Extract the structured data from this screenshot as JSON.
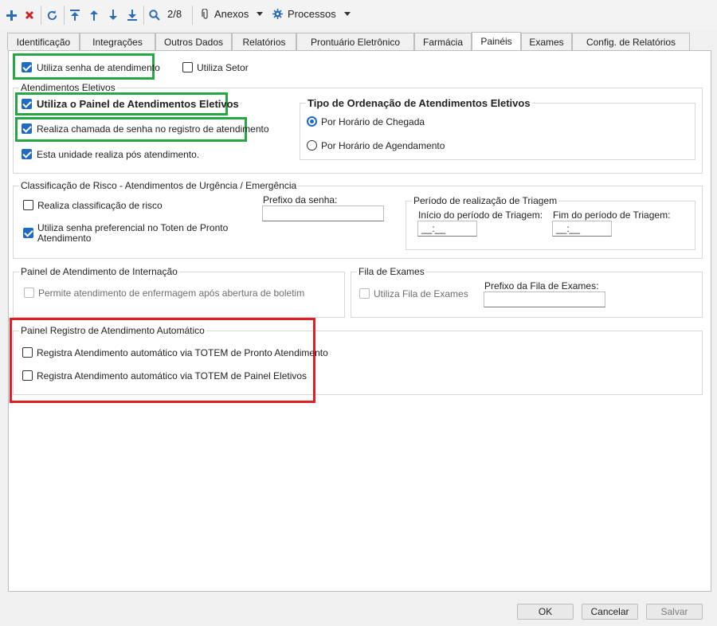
{
  "toolbar": {
    "add_icon": "plus-icon",
    "delete_icon": "x-icon",
    "refresh_icon": "refresh-icon",
    "record_counter": "2/8",
    "anexos_label": "Anexos",
    "processos_label": "Processos",
    "colors": {
      "blue": "#2b6cb8",
      "red": "#d0202a"
    }
  },
  "tabs": [
    {
      "label": "Identificação",
      "active": false
    },
    {
      "label": "Integrações",
      "active": false
    },
    {
      "label": "Outros Dados",
      "active": false
    },
    {
      "label": "Relatórios",
      "active": false
    },
    {
      "label": "Prontuário Eletrônico",
      "active": false
    },
    {
      "label": "Farmácia",
      "active": false
    },
    {
      "label": "Painéis",
      "active": true
    },
    {
      "label": "Exames",
      "active": false
    },
    {
      "label": "Config. de Relatórios",
      "active": false
    }
  ],
  "top": {
    "utiliza_senha": {
      "label": "Utiliza senha de atendimento",
      "checked": true
    },
    "utiliza_setor": {
      "label": "Utiliza Setor",
      "checked": false
    }
  },
  "eletivos": {
    "title": "Atendimentos Eletivos",
    "painel": {
      "label": "Utiliza o Painel de Atendimentos Eletivos",
      "checked": true
    },
    "chamada": {
      "label": "Realiza chamada de senha no registro de atendimento",
      "checked": true
    },
    "pos": {
      "label": "Esta unidade realiza pós atendimento.",
      "checked": true
    },
    "ordenacao_title": "Tipo de Ordenação de Atendimentos Eletivos",
    "ordem_chegada": {
      "label": "Por Horário de Chegada",
      "selected": true
    },
    "ordem_agendamento": {
      "label": "Por Horário de Agendamento",
      "selected": false
    }
  },
  "risco": {
    "title": "Classificação de Risco - Atendimentos de Urgência / Emergência",
    "classificacao": {
      "label": "Realiza classificação de risco",
      "checked": false
    },
    "preferencial_line1": "Utiliza senha preferencial no Toten de Pronto",
    "preferencial_line2": "Atendimento",
    "preferencial_checked": true,
    "prefixo_label": "Prefixo da senha:",
    "prefixo_value": "",
    "triagem_title": "Período de realização de Triagem",
    "inicio_label": "Início do período de Triagem:",
    "inicio_value": "__:__",
    "fim_label": "Fim do período de Triagem:",
    "fim_value": "__:__"
  },
  "internacao": {
    "title": "Painel de Atendimento de Internação",
    "permite": {
      "label": "Permite atendimento de enfermagem após abertura de boletim",
      "checked": false
    }
  },
  "exames": {
    "title": "Fila de Exames",
    "utiliza": {
      "label": "Utiliza Fila de Exames",
      "checked": false
    },
    "prefixo_label": "Prefixo da Fila de Exames:",
    "prefixo_value": ""
  },
  "automatico": {
    "title": "Painel Registro de Atendimento Automático",
    "pronto": {
      "label": "Registra Atendimento automático via TOTEM de Pronto Atendimento",
      "checked": false
    },
    "eletivos": {
      "label": "Registra Atendimento automático via TOTEM de Painel Eletivos",
      "checked": false
    }
  },
  "footer": {
    "ok": "OK",
    "cancelar": "Cancelar",
    "salvar": "Salvar"
  },
  "highlight_colors": {
    "green": "#27a744",
    "red": "#e01e26"
  }
}
